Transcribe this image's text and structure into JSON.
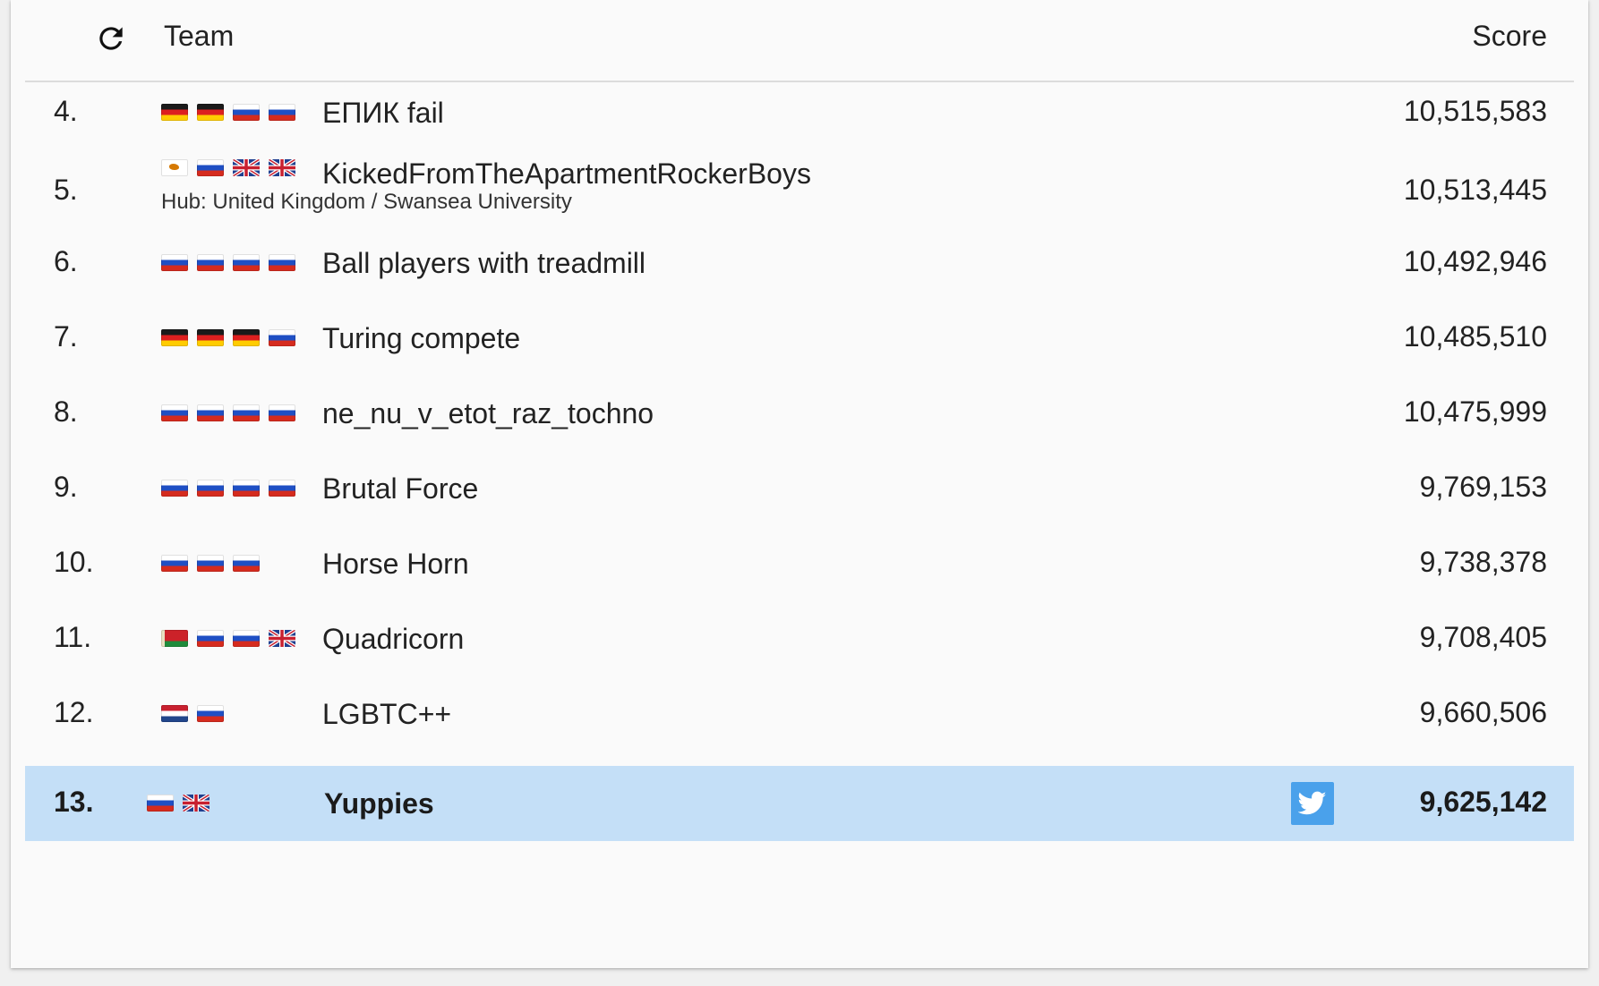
{
  "header": {
    "refresh_icon": "refresh-icon",
    "team_label": "Team",
    "score_label": "Score"
  },
  "rows": [
    {
      "rank": "4.",
      "flags": [
        "de",
        "de",
        "ru",
        "ru"
      ],
      "name": "ЕПИК fail",
      "score": "10,515,583"
    },
    {
      "rank": "5.",
      "flags": [
        "cy",
        "ru",
        "gb",
        "gb"
      ],
      "name": "KickedFromTheApartmentRockerBoys",
      "hub": "Hub: United Kingdom / Swansea University",
      "score": "10,513,445"
    },
    {
      "rank": "6.",
      "flags": [
        "ru",
        "ru",
        "ru",
        "ru"
      ],
      "name": "Ball players with treadmill",
      "score": "10,492,946"
    },
    {
      "rank": "7.",
      "flags": [
        "de",
        "de",
        "de",
        "ru"
      ],
      "name": "Turing compete",
      "score": "10,485,510"
    },
    {
      "rank": "8.",
      "flags": [
        "ru",
        "ru",
        "ru",
        "ru"
      ],
      "name": "ne_nu_v_etot_raz_tochno",
      "score": "10,475,999"
    },
    {
      "rank": "9.",
      "flags": [
        "ru",
        "ru",
        "ru",
        "ru"
      ],
      "name": "Brutal Force",
      "score": "9,769,153"
    },
    {
      "rank": "10.",
      "flags": [
        "ru",
        "ru",
        "ru"
      ],
      "name": "Horse Horn",
      "score": "9,738,378"
    },
    {
      "rank": "11.",
      "flags": [
        "by",
        "ru",
        "ru",
        "gb"
      ],
      "name": "Quadricorn",
      "score": "9,708,405"
    },
    {
      "rank": "12.",
      "flags": [
        "nl",
        "ru"
      ],
      "name": "LGBTC++",
      "score": "9,660,506"
    },
    {
      "rank": "13.",
      "flags": [
        "ru",
        "gb"
      ],
      "name": "Yuppies",
      "score": "9,625,142",
      "highlighted": true,
      "twitter_icon": "twitter-icon"
    }
  ],
  "colors": {
    "highlight_row": "#c4dff7",
    "twitter_button": "#4aa1eb"
  }
}
